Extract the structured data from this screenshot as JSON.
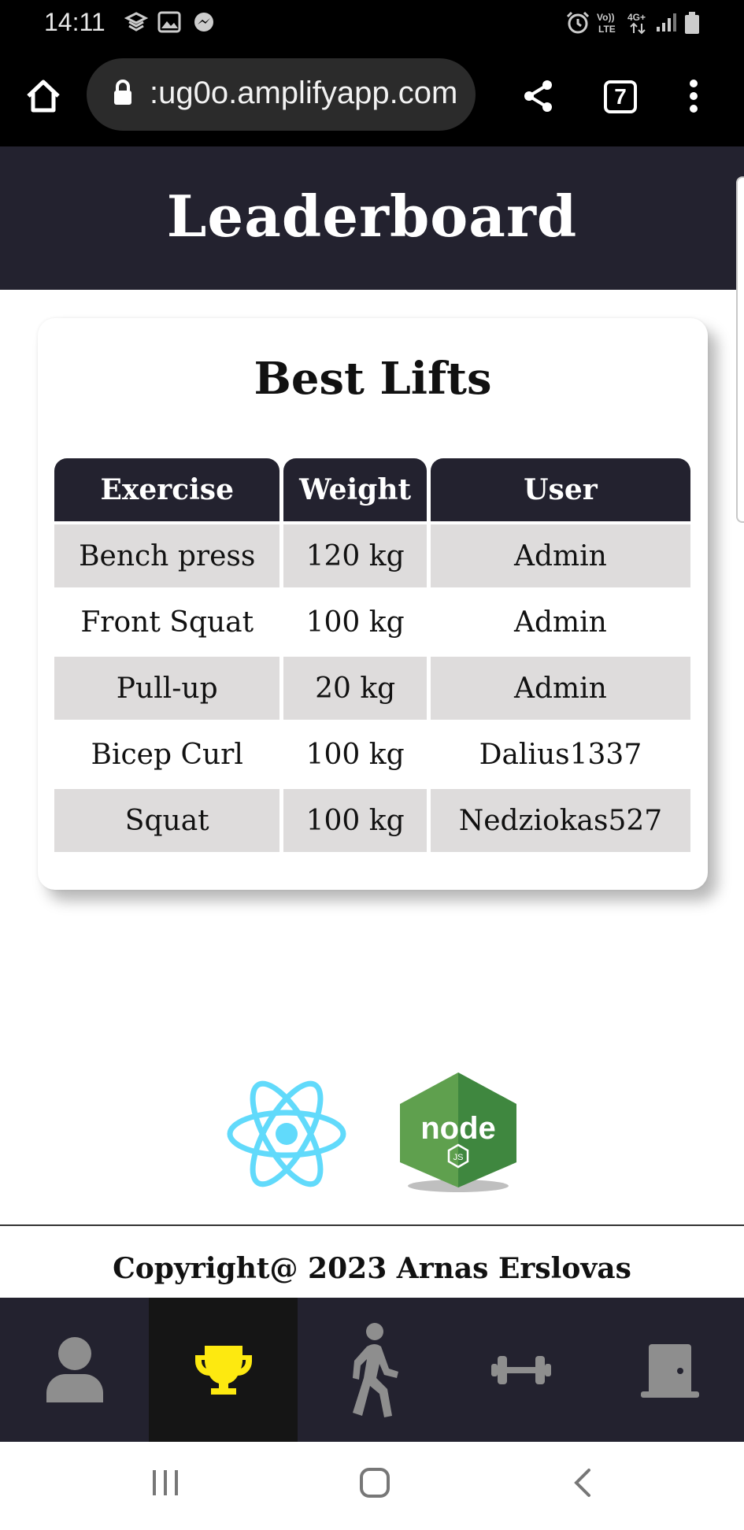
{
  "status_bar": {
    "time": "14:11"
  },
  "browser": {
    "url": ":ug0o.amplifyapp.com",
    "tab_count": "7"
  },
  "page": {
    "title": "Leaderboard"
  },
  "card": {
    "title": "Best Lifts",
    "columns": [
      "Exercise",
      "Weight",
      "User"
    ],
    "rows": [
      [
        "Bench press",
        "120 kg",
        "Admin"
      ],
      [
        "Front Squat",
        "100 kg",
        "Admin"
      ],
      [
        "Pull-up",
        "20 kg",
        "Admin"
      ],
      [
        "Bicep Curl",
        "100 kg",
        "Dalius1337"
      ],
      [
        "Squat",
        "100 kg",
        "Nedziokas527"
      ]
    ]
  },
  "footer": {
    "copyright": "Copyright@ 2023 Arnas Erslovas"
  },
  "app_nav": {
    "items": [
      "profile-icon",
      "trophy-icon",
      "walking-icon",
      "dumbbell-icon",
      "door-icon"
    ],
    "active": "trophy-icon"
  },
  "colors": {
    "header_bg": "#23222f",
    "active_icon": "#fde910",
    "inactive_icon": "#8e8e8e",
    "row_shade": "#dedcdc"
  }
}
